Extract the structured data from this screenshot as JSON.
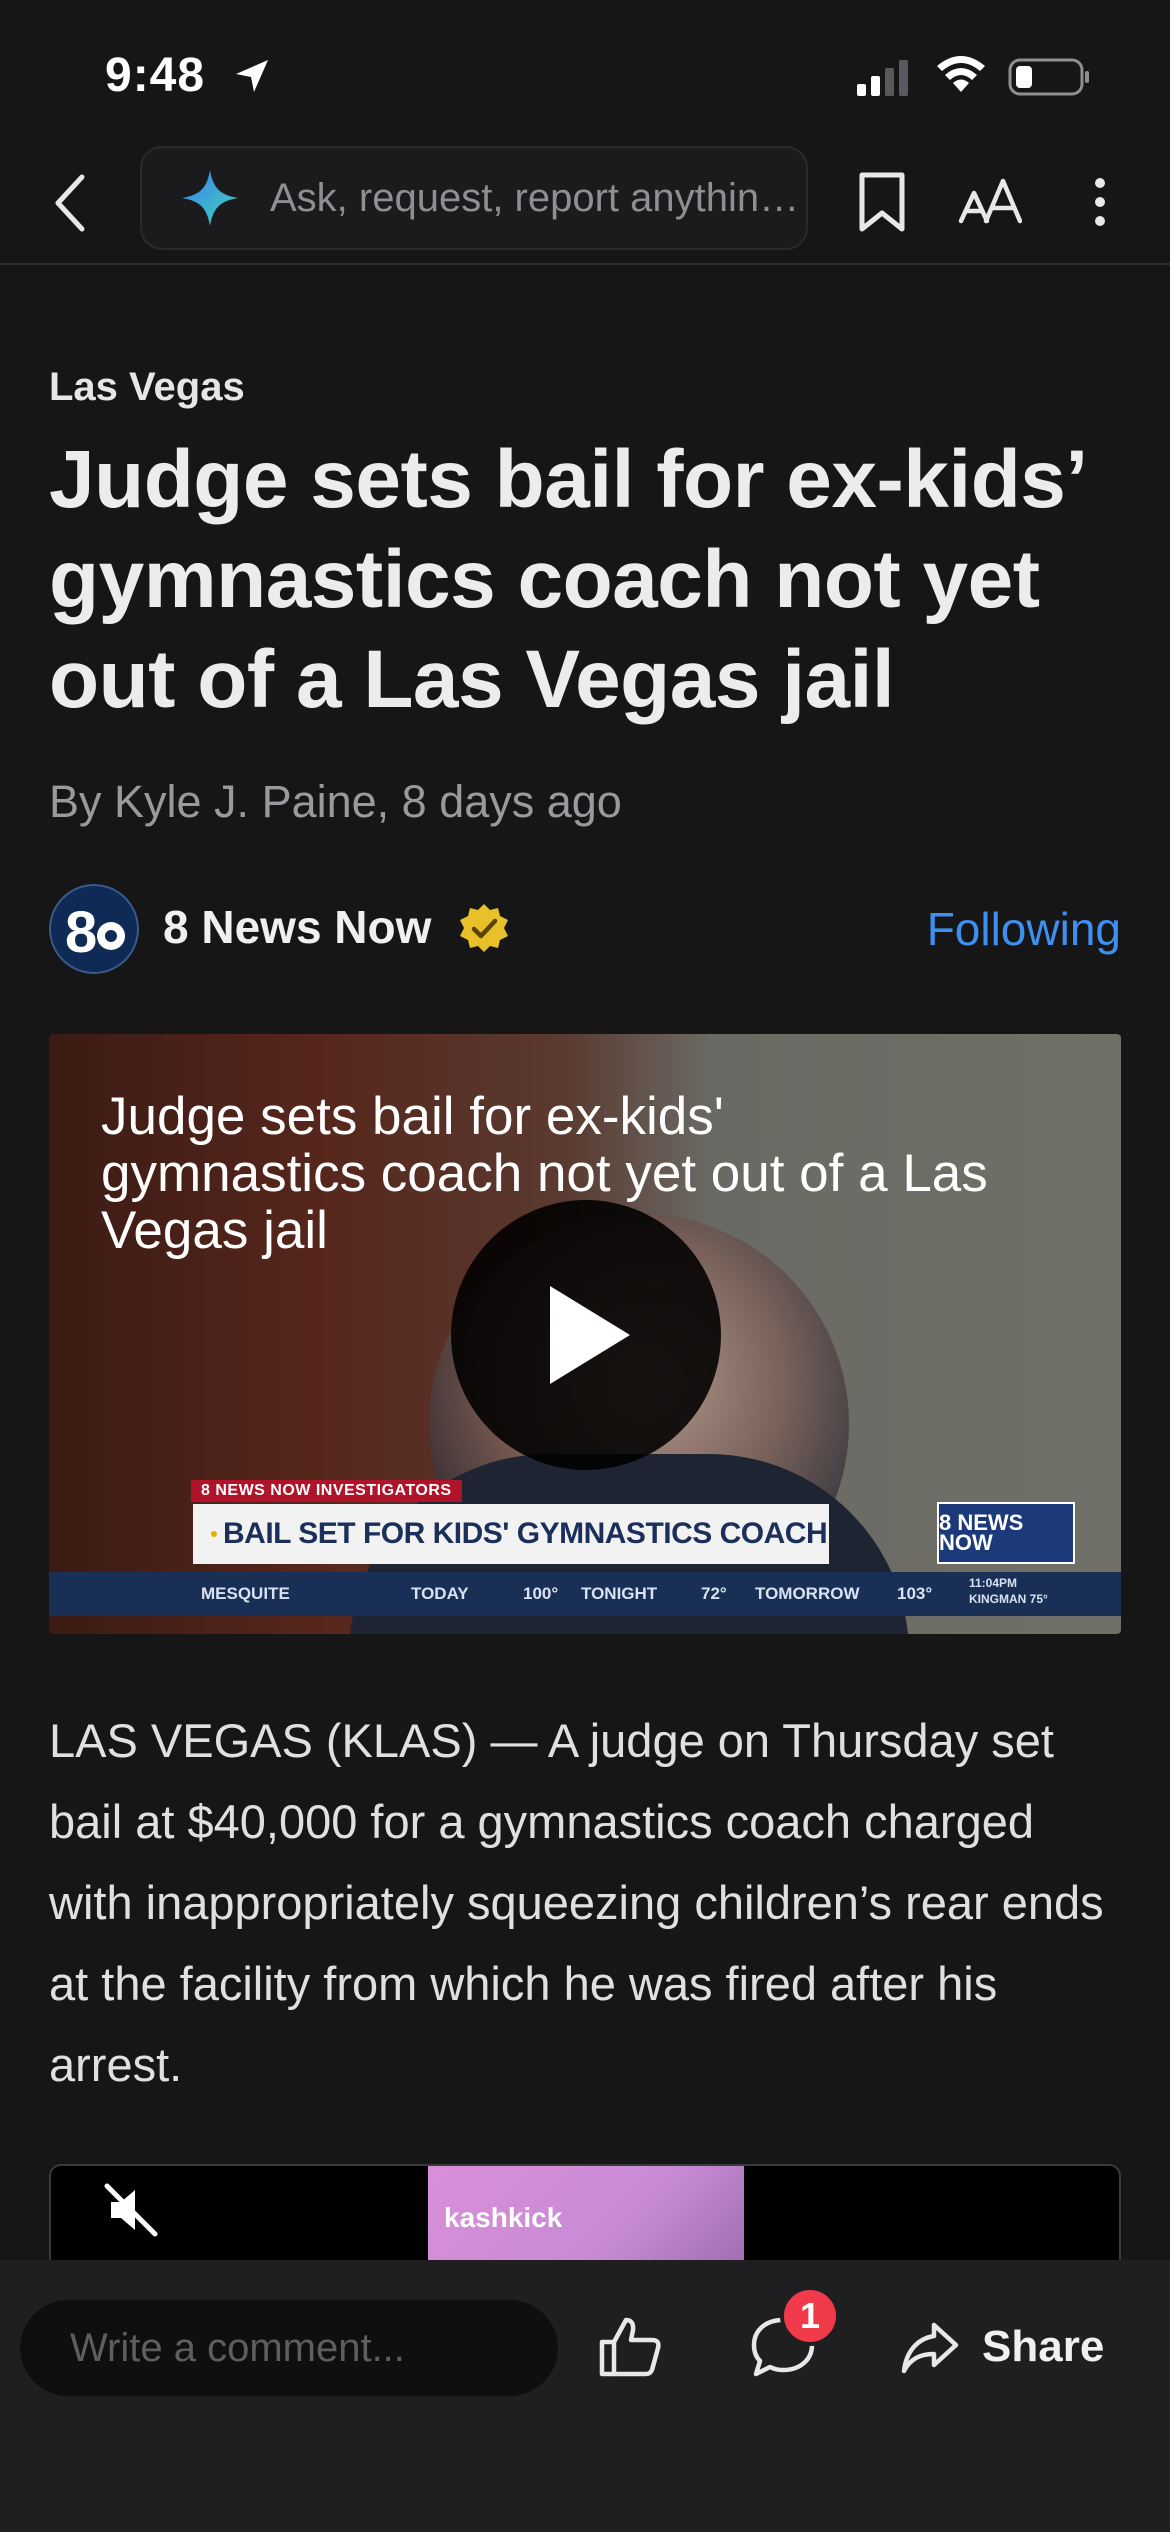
{
  "status_bar": {
    "time": "9:48"
  },
  "top_nav": {
    "search_placeholder": "Ask, request, report anything..."
  },
  "article": {
    "category": "Las Vegas",
    "headline": "Judge sets bail for ex-kids’ gymnastics coach not yet out of a Las Vegas jail",
    "byline": "By Kyle J. Paine,  8 days ago",
    "publisher": {
      "name": "8 News Now",
      "follow_label": "Following",
      "logo_text": "8"
    },
    "video": {
      "title": "Judge sets bail for ex-kids' gymnastics coach not yet out of a Las Vegas jail",
      "tag": "8 NEWS NOW INVESTIGATORS",
      "lower_third": "BAIL SET FOR KIDS' GYMNASTICS COACH",
      "logo_text": "8 NEWS NOW",
      "ticker": {
        "location": "MESQUITE",
        "today": "TODAY",
        "today_temp": "100°",
        "tonight": "TONIGHT",
        "tonight_temp": "72°",
        "tomorrow": "TOMORROW",
        "tomorrow_temp": "103°",
        "side_time": "11:04PM",
        "side_place": "KINGMAN 75°"
      }
    },
    "body": "LAS VEGAS (KLAS) — A judge on Thursday set bail at $40,000 for a gymnastics coach charged with inappropriately squeezing children’s rear ends at the facility from which he was fired after his arrest."
  },
  "ad": {
    "brand": "kashkick"
  },
  "bottom_bar": {
    "comment_placeholder": "Write a comment...",
    "comment_count": "1",
    "share_label": "Share"
  },
  "colors": {
    "background": "#161617",
    "accent": "#3d8ff0",
    "badge": "#f03a4a",
    "verified": "#e8c02a"
  }
}
